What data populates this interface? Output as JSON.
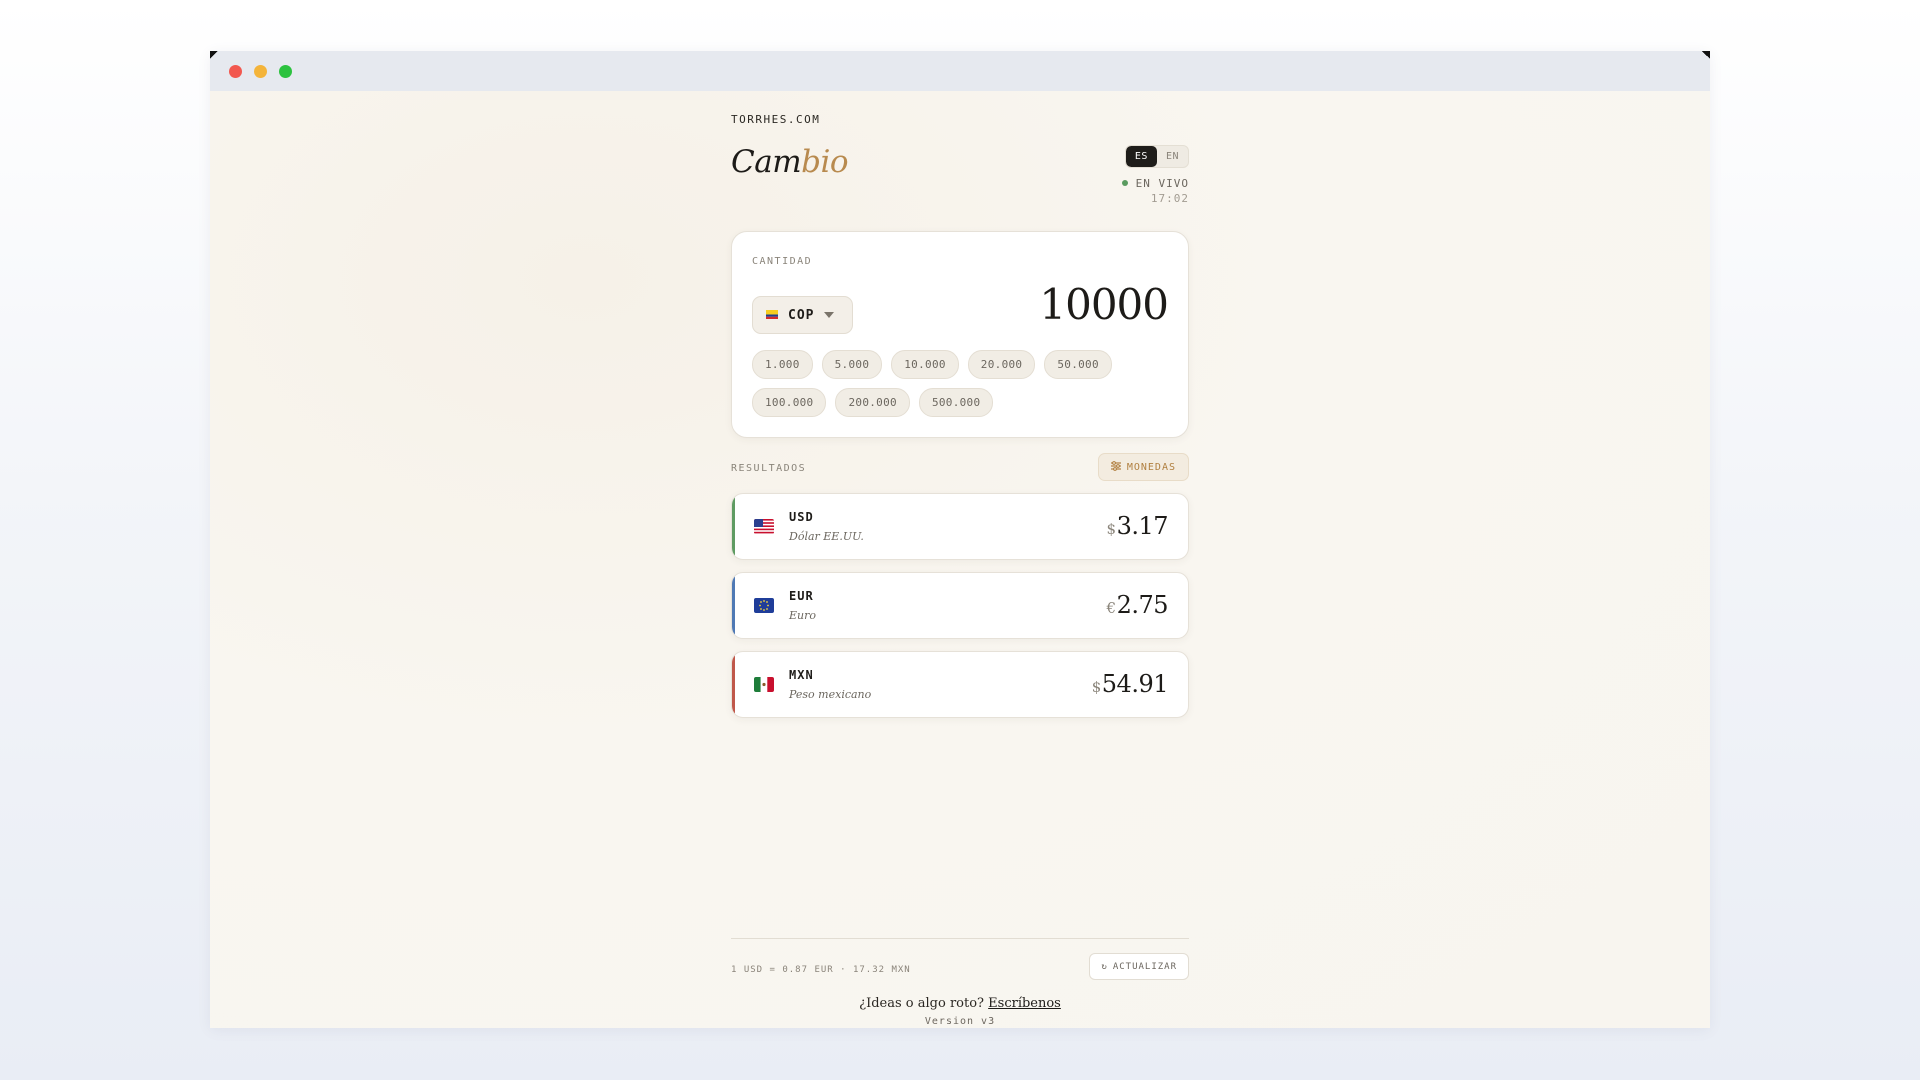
{
  "site": {
    "brand": "TORRHES.COM",
    "logo_part1": "Cam",
    "logo_part2": "bio"
  },
  "language": {
    "options": [
      "ES",
      "EN"
    ],
    "active": "ES"
  },
  "status": {
    "live_label": "EN VIVO",
    "time": "17:02"
  },
  "amount_card": {
    "label": "CANTIDAD",
    "currency": "COP",
    "currency_flag": "colombia-flag",
    "amount": "10000",
    "presets": [
      "1.000",
      "5.000",
      "10.000",
      "20.000",
      "50.000",
      "100.000",
      "200.000",
      "500.000"
    ]
  },
  "results": {
    "label": "RESULTADOS",
    "currencies_button": "MONEDAS",
    "items": [
      {
        "code": "USD",
        "name": "Dólar EE.UU.",
        "symbol": "$",
        "value": "3.17",
        "accent": "#5f9b62",
        "flag": "usa-flag"
      },
      {
        "code": "EUR",
        "name": "Euro",
        "symbol": "€",
        "value": "2.75",
        "accent": "#4f79b4",
        "flag": "eu-flag"
      },
      {
        "code": "MXN",
        "name": "Peso mexicano",
        "symbol": "$",
        "value": "54.91",
        "accent": "#c0584a",
        "flag": "mexico-flag"
      }
    ]
  },
  "footer": {
    "rates": "1 USD = 0.87 EUR · 17.32 MXN",
    "refresh_button": "ACTUALIZAR",
    "feedback_text": "¿Ideas o algo roto?",
    "feedback_link": "Escríbenos",
    "version": "Version v3"
  },
  "colors": {
    "accent": "#b88a4e",
    "background": "#f8f5ef",
    "live": "#5a9b5f"
  }
}
